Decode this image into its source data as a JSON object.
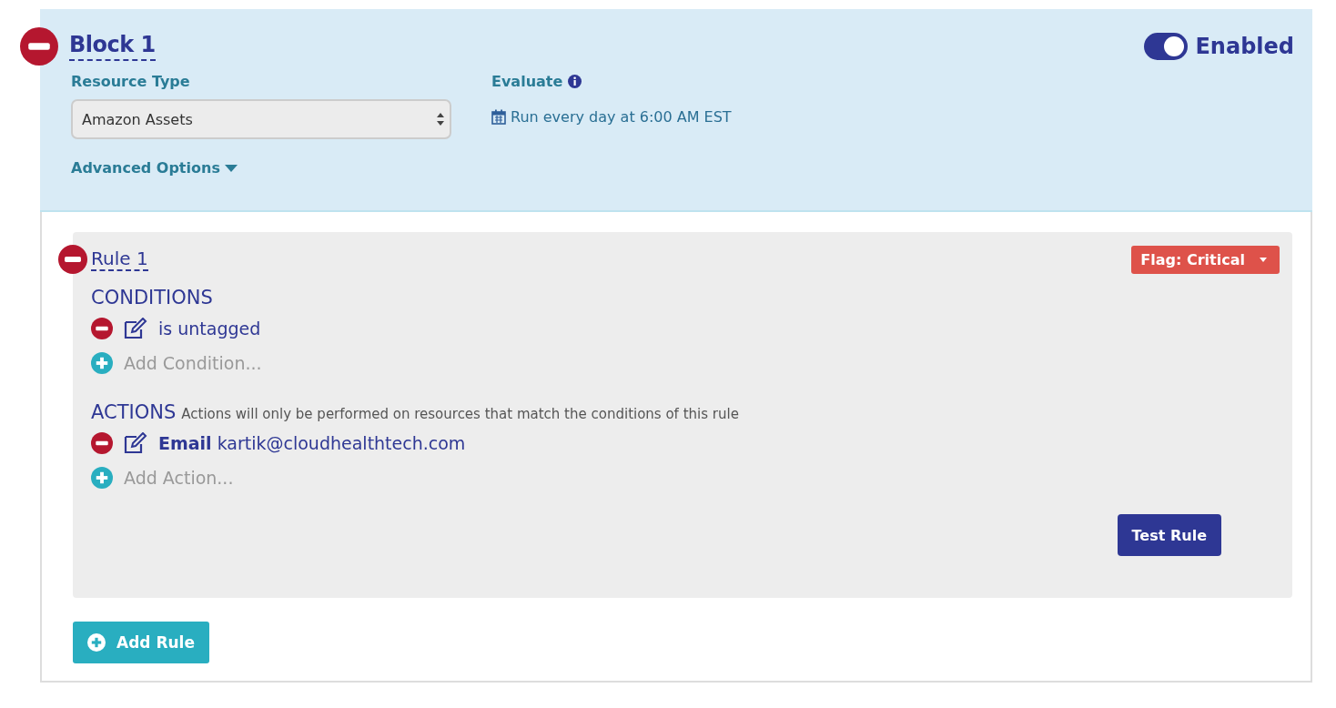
{
  "block": {
    "title": "Block 1",
    "enabled": {
      "on": true,
      "label": "Enabled"
    },
    "resource_type": {
      "label": "Resource Type",
      "value": "Amazon Assets"
    },
    "evaluate": {
      "label": "Evaluate",
      "schedule": "Run every day at 6:00 AM EST"
    },
    "advanced_options": {
      "label": "Advanced Options",
      "expanded": false
    }
  },
  "rules": [
    {
      "title": "Rule 1",
      "flag": "Flag: Critical",
      "conditions": {
        "heading": "CONDITIONS",
        "items": [
          "is untagged"
        ],
        "add": "Add Condition..."
      },
      "actions": {
        "heading": "ACTIONS",
        "note": "Actions will only be performed on resources that match the conditions of this rule",
        "items": [
          "**Email** kartik@cloudhealthtech.com"
        ],
        "add": "Add Action..."
      },
      "test_button": "Test Rule"
    }
  ],
  "add_rule": "Add Rule"
}
